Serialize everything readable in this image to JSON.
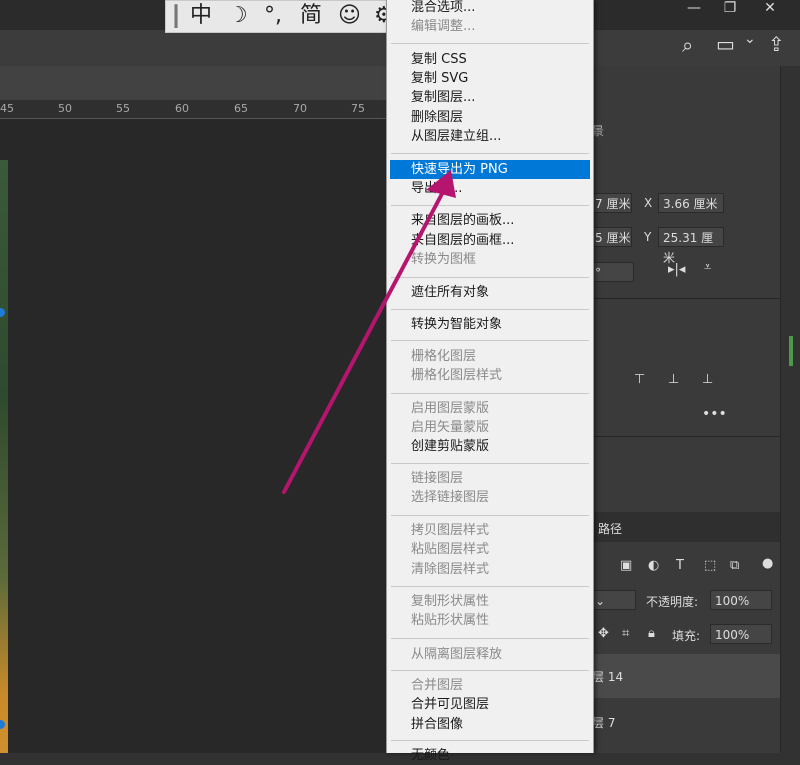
{
  "ime_toolbar": {
    "separator": "┃",
    "chinese": "中",
    "moon": "☽",
    "punct": "°,",
    "simplified": "简",
    "emoji": "☺",
    "settings": "⚙"
  },
  "window_controls": {
    "minimize": "—",
    "restore": "❐",
    "close": "✕"
  },
  "toolbar_icons": {
    "search": "⌕",
    "workspace": "▭",
    "workspace_arrow": "⌄",
    "share": "⇪"
  },
  "ruler": {
    "labels": [
      "45",
      "50",
      "55",
      "60",
      "65",
      "70",
      "75"
    ]
  },
  "menu": {
    "items": [
      {
        "label": "混合选项...",
        "state": "enabled"
      },
      {
        "label": "编辑调整...",
        "state": "disabled"
      },
      {
        "sep": true
      },
      {
        "label": "复制 CSS",
        "state": "enabled"
      },
      {
        "label": "复制 SVG",
        "state": "enabled"
      },
      {
        "label": "复制图层...",
        "state": "enabled"
      },
      {
        "label": "删除图层",
        "state": "enabled"
      },
      {
        "label": "从图层建立组...",
        "state": "enabled"
      },
      {
        "sep": true
      },
      {
        "label": "快速导出为 PNG",
        "state": "selected"
      },
      {
        "label": "导出为...",
        "state": "enabled"
      },
      {
        "sep": true
      },
      {
        "label": "来自图层的画板...",
        "state": "enabled"
      },
      {
        "label": "来自图层的画框...",
        "state": "enabled"
      },
      {
        "label": "转换为图框",
        "state": "disabled"
      },
      {
        "sep": true
      },
      {
        "label": "遮住所有对象",
        "state": "enabled"
      },
      {
        "sep": true
      },
      {
        "label": "转换为智能对象",
        "state": "enabled"
      },
      {
        "sep": true
      },
      {
        "label": "栅格化图层",
        "state": "disabled"
      },
      {
        "label": "栅格化图层样式",
        "state": "disabled"
      },
      {
        "sep": true
      },
      {
        "label": "启用图层蒙版",
        "state": "disabled"
      },
      {
        "label": "启用矢量蒙版",
        "state": "disabled"
      },
      {
        "label": "创建剪贴蒙版",
        "state": "enabled"
      },
      {
        "sep": true
      },
      {
        "label": "链接图层",
        "state": "disabled"
      },
      {
        "label": "选择链接图层",
        "state": "disabled"
      },
      {
        "sep": true
      },
      {
        "label": "拷贝图层样式",
        "state": "disabled"
      },
      {
        "label": "粘贴图层样式",
        "state": "disabled"
      },
      {
        "label": "清除图层样式",
        "state": "disabled"
      },
      {
        "sep": true
      },
      {
        "label": "复制形状属性",
        "state": "disabled"
      },
      {
        "label": "粘贴形状属性",
        "state": "disabled"
      },
      {
        "sep": true
      },
      {
        "label": "从隔离图层释放",
        "state": "disabled"
      },
      {
        "sep": true
      },
      {
        "label": "合并图层",
        "state": "disabled"
      },
      {
        "label": "合并可见图层",
        "state": "enabled"
      },
      {
        "label": "拼合图像",
        "state": "enabled"
      },
      {
        "sep": true
      },
      {
        "label": "无颜色",
        "state": "enabled"
      }
    ]
  },
  "properties": {
    "w_value": "7 厘米",
    "h_value": "5 厘米",
    "x_label": "X",
    "x_value": "3.66 厘米",
    "y_label": "Y",
    "y_value": "25.31 厘米",
    "angle_value": "°",
    "more": "•••",
    "side_char": "景"
  },
  "layers": {
    "tab_paths": "路径",
    "opacity_label": "不透明度:",
    "opacity_value": "100%",
    "fill_label": "填充:",
    "fill_value": "100%",
    "layer14": "层 14",
    "layer7": "层 7"
  },
  "colors": {
    "accent": "#0078d7",
    "annotation_arrow": "#b5156e",
    "menu_bg": "#f0f0f0"
  }
}
